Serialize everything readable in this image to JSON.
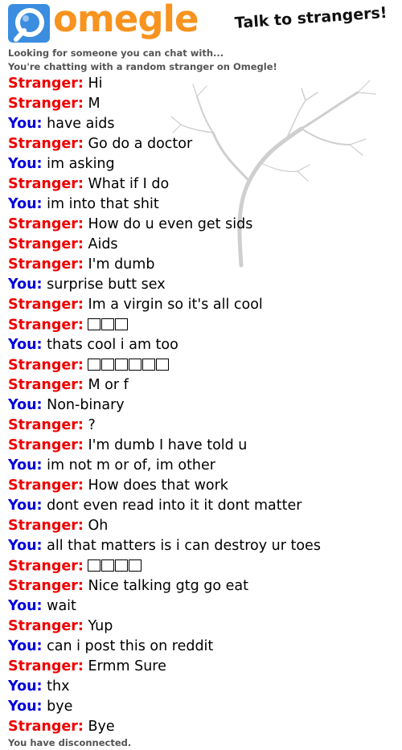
{
  "header": {
    "logo_text": "omegle",
    "tagline": "Talk to strangers!",
    "brand_orange": "#f7931e",
    "brand_blue": "#3b8de0"
  },
  "status": {
    "looking": "Looking for someone you can chat with...",
    "chatting": "You're chatting with a random stranger on Omegle!",
    "disconnected": "You have disconnected."
  },
  "colors": {
    "stranger": "#ee0000",
    "you": "#0000dd"
  },
  "messages": [
    {
      "sender": "Stranger:",
      "text": "Hi"
    },
    {
      "sender": "Stranger:",
      "text": "M"
    },
    {
      "sender": "You:",
      "text": "have aids"
    },
    {
      "sender": "Stranger:",
      "text": "Go do a doctor"
    },
    {
      "sender": "You:",
      "text": "im asking"
    },
    {
      "sender": "Stranger:",
      "text": "What if I do"
    },
    {
      "sender": "You:",
      "text": "im into that shit"
    },
    {
      "sender": "Stranger:",
      "text": "How do u even get sids"
    },
    {
      "sender": "Stranger:",
      "text": "Aids"
    },
    {
      "sender": "Stranger:",
      "text": "I'm dumb"
    },
    {
      "sender": "You:",
      "text": "surprise butt sex"
    },
    {
      "sender": "Stranger:",
      "text": "Im a virgin so it's all cool"
    },
    {
      "sender": "Stranger:",
      "text": "",
      "emoji_boxes": 3
    },
    {
      "sender": "You:",
      "text": "thats cool i am too"
    },
    {
      "sender": "Stranger:",
      "text": "",
      "emoji_boxes": 6
    },
    {
      "sender": "Stranger:",
      "text": "M or f"
    },
    {
      "sender": "You:",
      "text": "Non-binary"
    },
    {
      "sender": "Stranger:",
      "text": "?"
    },
    {
      "sender": "Stranger:",
      "text": "I'm dumb I have told u"
    },
    {
      "sender": "You:",
      "text": "im not m or of, im other"
    },
    {
      "sender": "Stranger:",
      "text": "How does that work"
    },
    {
      "sender": "You:",
      "text": "dont even read into it it dont matter"
    },
    {
      "sender": "Stranger:",
      "text": "Oh"
    },
    {
      "sender": "You:",
      "text": "all that matters is i can destroy ur toes"
    },
    {
      "sender": "Stranger:",
      "text": "",
      "emoji_boxes": 4
    },
    {
      "sender": "Stranger:",
      "text": "Nice talking gtg go eat"
    },
    {
      "sender": "You:",
      "text": "wait"
    },
    {
      "sender": "Stranger:",
      "text": "Yup"
    },
    {
      "sender": "You:",
      "text": "can i post this on reddit"
    },
    {
      "sender": "Stranger:",
      "text": "Ermm Sure"
    },
    {
      "sender": "You:",
      "text": "thx"
    },
    {
      "sender": "You:",
      "text": "bye"
    },
    {
      "sender": "Stranger:",
      "text": "Bye"
    }
  ]
}
